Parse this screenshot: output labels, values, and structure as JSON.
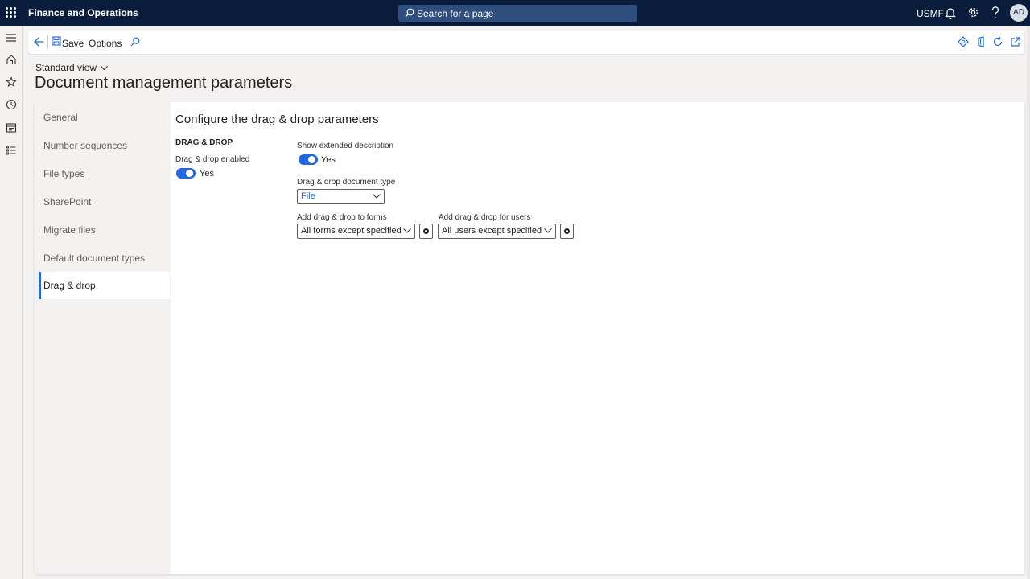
{
  "app": {
    "title": "Finance and Operations"
  },
  "search": {
    "placeholder": "Search for a page"
  },
  "header": {
    "company": "USMF",
    "user_initials": "AD"
  },
  "toolbar": {
    "save_label": "Save",
    "options_label": "Options"
  },
  "page": {
    "view_label": "Standard view",
    "title": "Document management parameters"
  },
  "tabs": [
    {
      "label": "General"
    },
    {
      "label": "Number sequences"
    },
    {
      "label": "File types"
    },
    {
      "label": "SharePoint"
    },
    {
      "label": "Migrate files"
    },
    {
      "label": "Default document types"
    },
    {
      "label": "Drag & drop"
    }
  ],
  "active_tab": "Drag & drop",
  "section": {
    "title": "Configure the drag & drop parameters",
    "group_title": "DRAG & DROP",
    "drag_drop_enabled": {
      "label": "Drag & drop enabled",
      "value": "Yes"
    },
    "show_extended_description": {
      "label": "Show extended description",
      "value": "Yes"
    },
    "document_type": {
      "label": "Drag & drop document type",
      "value": "File"
    },
    "add_to_forms": {
      "label": "Add drag & drop to forms",
      "value": "All forms except specified"
    },
    "for_users": {
      "label": "Add drag & drop for users",
      "value": "All users except specified"
    }
  },
  "colors": {
    "accent": "#2266e3",
    "topbar": "#0a1c3b",
    "search_bg": "#2e4f7e"
  },
  "icons": {
    "top": [
      "waffle-icon",
      "search-icon",
      "bell-icon",
      "gear-icon",
      "help-icon"
    ],
    "rail": [
      "hamburger-icon",
      "home-icon",
      "star-icon",
      "clock-icon",
      "workspace-icon",
      "modules-icon"
    ],
    "actionpane_right": [
      "diamond-icon",
      "office-icon",
      "refresh-icon",
      "open-new-window-icon"
    ]
  }
}
